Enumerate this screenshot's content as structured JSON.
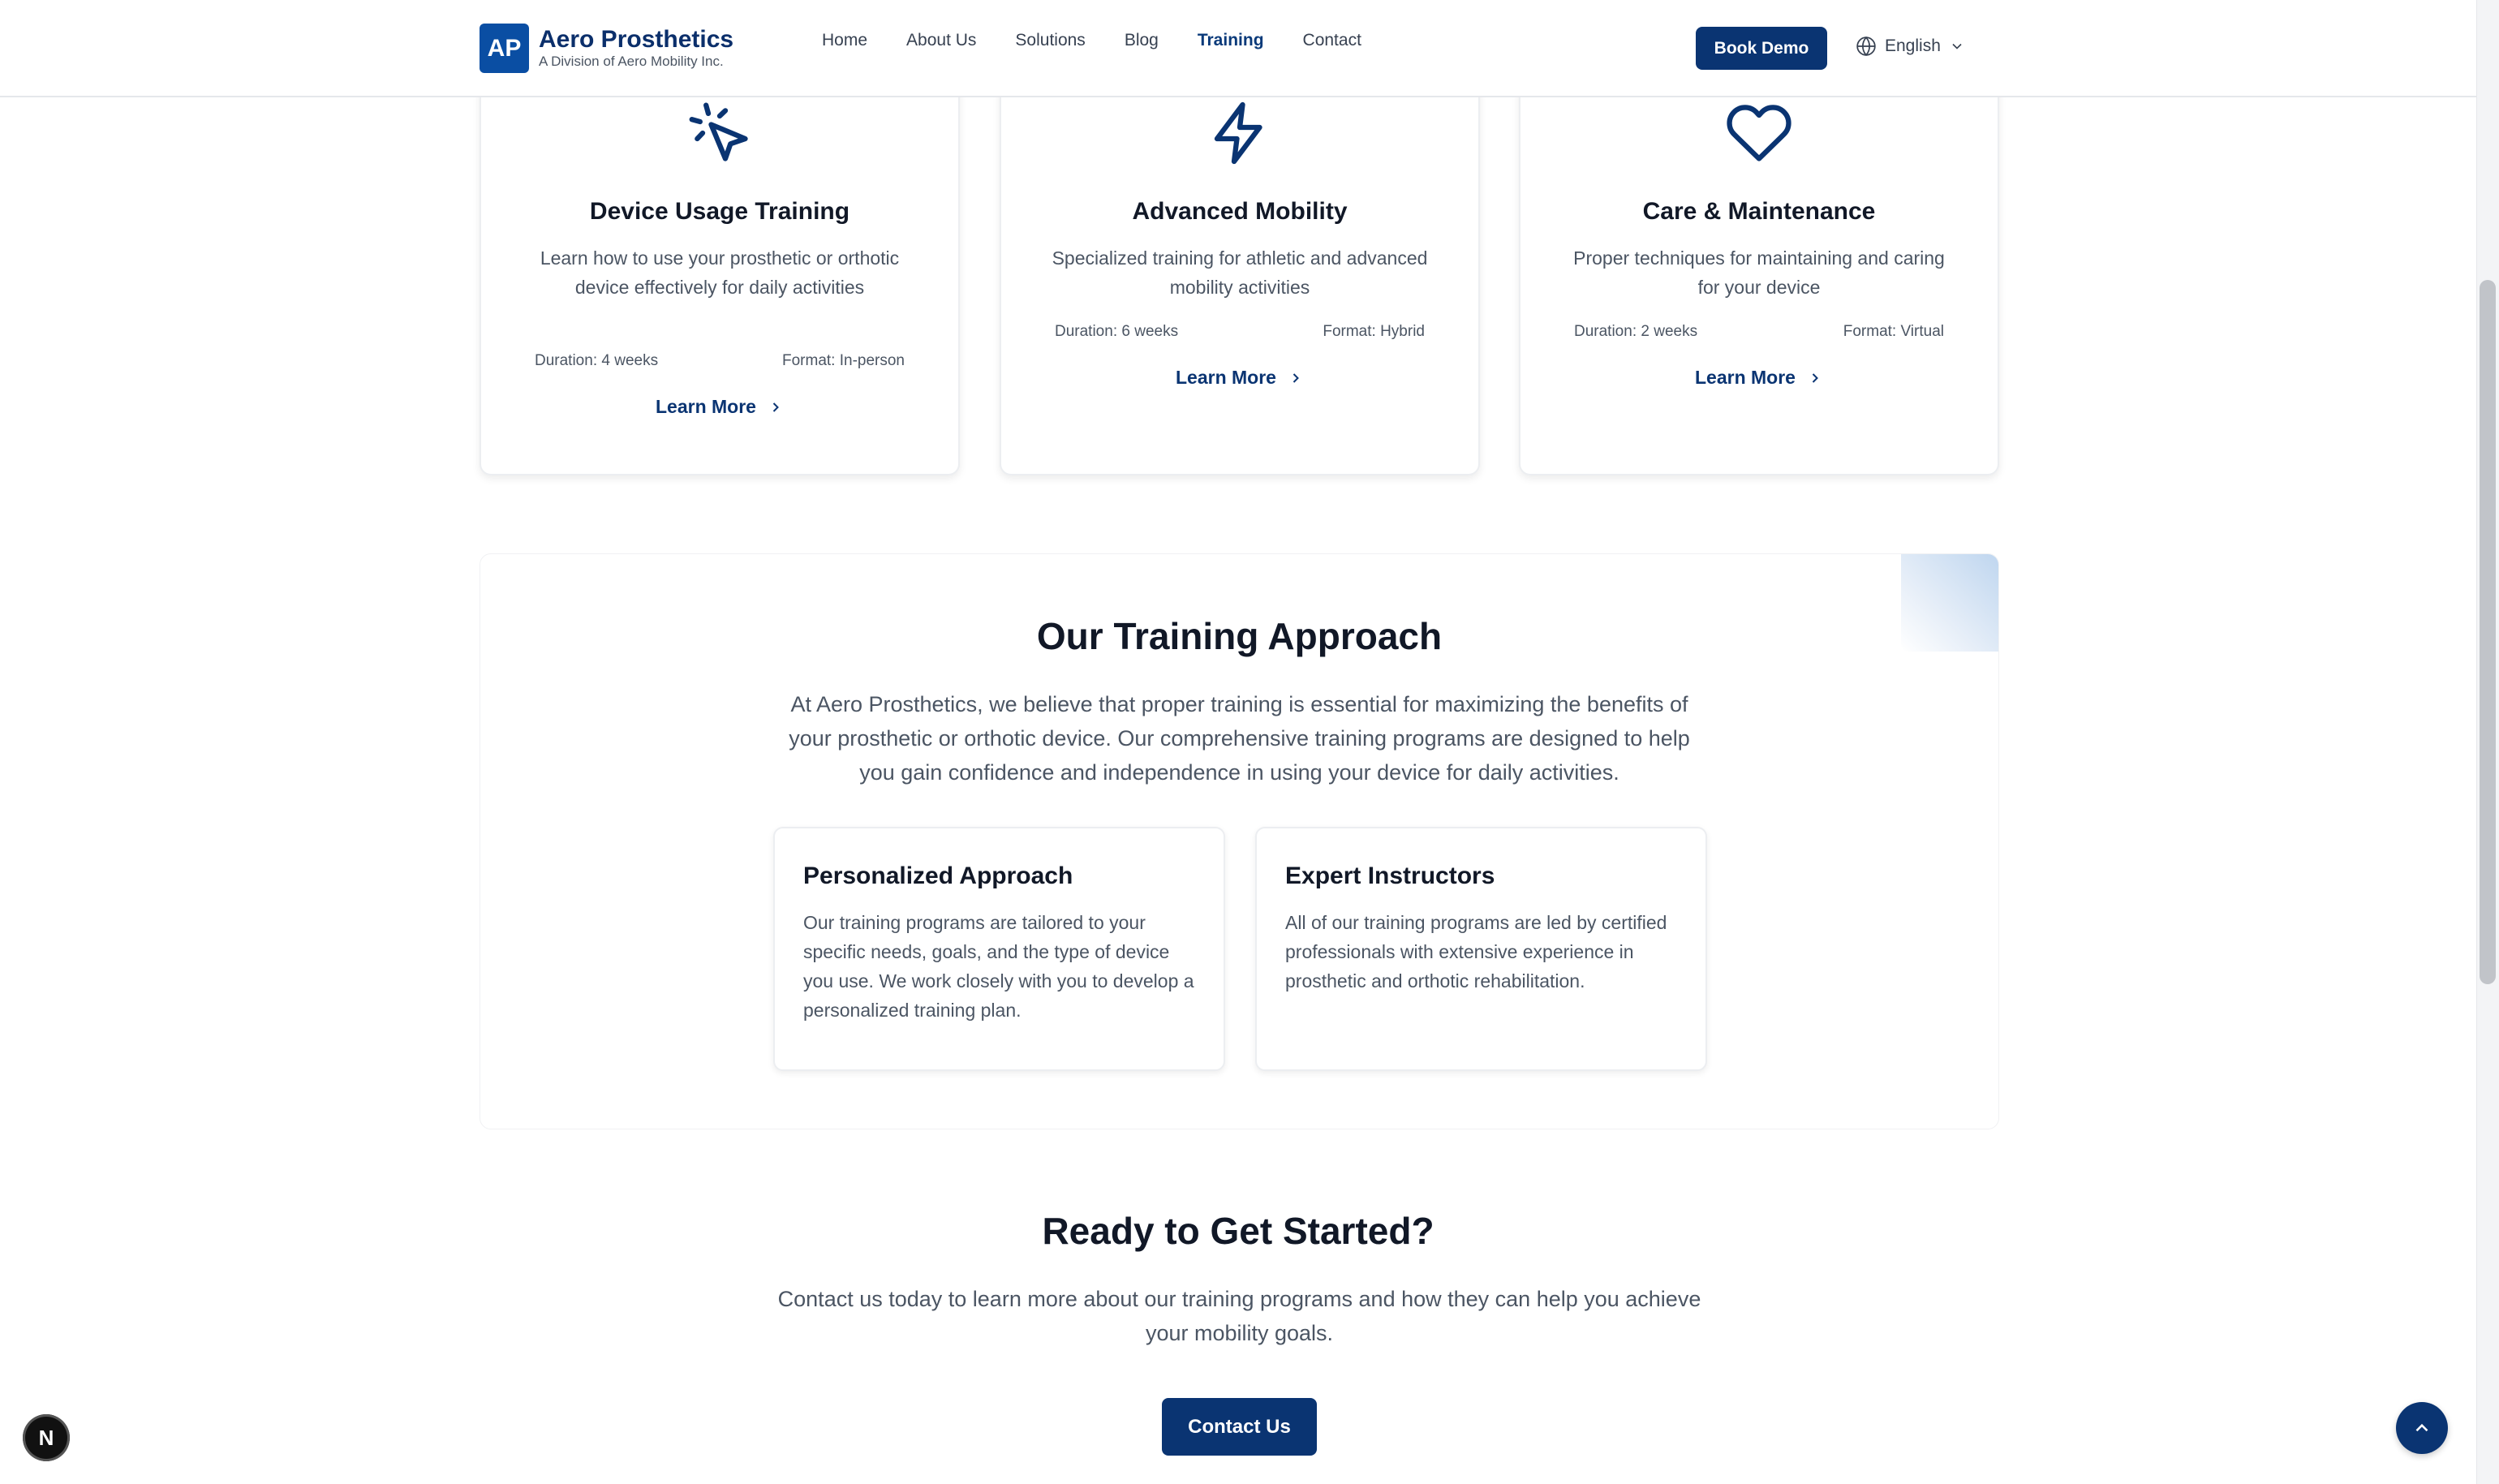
{
  "brand": {
    "initials": "AP",
    "name": "Aero Prosthetics",
    "subtitle": "A Division of Aero Mobility Inc.",
    "color": "#0a3472"
  },
  "nav": {
    "items": [
      {
        "label": "Home"
      },
      {
        "label": "About Us"
      },
      {
        "label": "Solutions"
      },
      {
        "label": "Blog"
      },
      {
        "label": "Training"
      },
      {
        "label": "Contact"
      }
    ],
    "active": "Training",
    "cta_label": "Book Demo",
    "language": "English"
  },
  "programs": [
    {
      "icon": "cursor-click-icon",
      "title": "Device Usage Training",
      "description": "Learn how to use your prosthetic or orthotic device effectively for daily activities",
      "duration": "Duration: 4 weeks",
      "format": "Format: In-person",
      "link": "Learn More"
    },
    {
      "icon": "lightning-icon",
      "title": "Advanced Mobility",
      "description": "Specialized training for athletic and advanced mobility activities",
      "duration": "Duration: 6 weeks",
      "format": "Format: Hybrid",
      "link": "Learn More"
    },
    {
      "icon": "heart-icon",
      "title": "Care & Maintenance",
      "description": "Proper techniques for maintaining and caring for your device",
      "duration": "Duration: 2 weeks",
      "format": "Format: Virtual",
      "link": "Learn More"
    }
  ],
  "approach": {
    "title": "Our Training Approach",
    "text": "At Aero Prosthetics, we believe that proper training is essential for maximizing the benefits of your prosthetic or orthotic device. Our comprehensive training programs are designed to help you gain confidence and independence in using your device for daily activities.",
    "features": [
      {
        "title": "Personalized Approach",
        "text": "Our training programs are tailored to your specific needs, goals, and the type of device you use. We work closely with you to develop a personalized training plan."
      },
      {
        "title": "Expert Instructors",
        "text": "All of our training programs are led by certified professionals with extensive experience in prosthetic and orthotic rehabilitation."
      }
    ]
  },
  "cta": {
    "title": "Ready to Get Started?",
    "text": "Contact us today to learn more about our training programs and how they can help you achieve your mobility goals.",
    "button": "Contact Us"
  },
  "floating": {
    "badge": "N"
  }
}
